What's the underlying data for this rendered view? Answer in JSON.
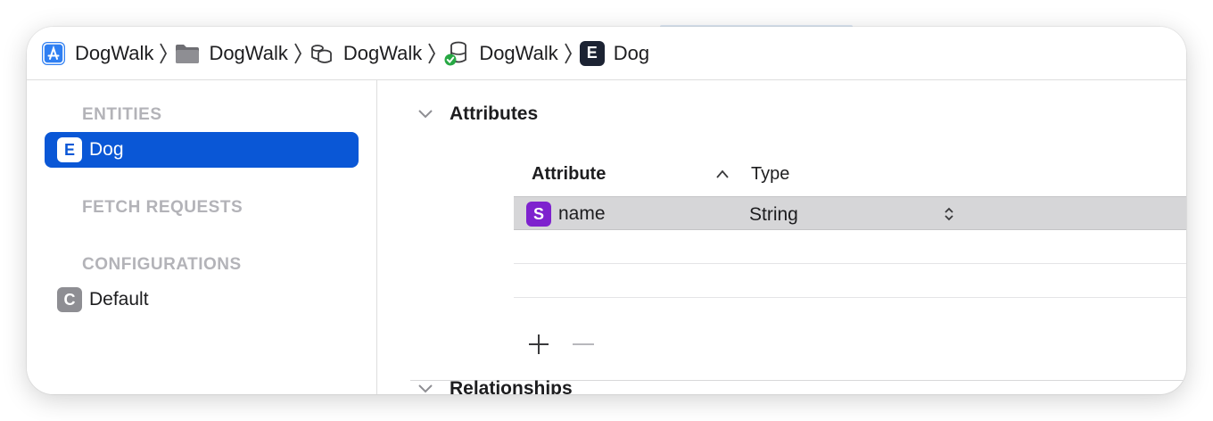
{
  "breadcrumb": [
    {
      "icon": "app-store-icon",
      "label": "DogWalk"
    },
    {
      "icon": "folder-icon",
      "label": "DogWalk"
    },
    {
      "icon": "data-model-group-icon",
      "label": "DogWalk"
    },
    {
      "icon": "data-model-version-icon",
      "label": "DogWalk"
    },
    {
      "icon": "entity-icon",
      "badge": "E",
      "label": "Dog"
    }
  ],
  "sidebar": {
    "entities_heading": "ENTITIES",
    "entities": [
      {
        "badge": "E",
        "label": "Dog",
        "selected": true
      }
    ],
    "fetch_heading": "FETCH REQUESTS",
    "configurations_heading": "CONFIGURATIONS",
    "configurations": [
      {
        "badge": "C",
        "label": "Default"
      }
    ]
  },
  "attributes": {
    "title": "Attributes",
    "col_attribute": "Attribute",
    "col_type": "Type",
    "rows": [
      {
        "badge": "S",
        "name": "name",
        "type": "String"
      }
    ]
  },
  "relationships": {
    "title": "Relationships"
  },
  "colors": {
    "selection": "#0a57d6",
    "string_badge": "#7e22ce",
    "entity_badge": "#1c2333",
    "config_badge": "#8e8e93"
  }
}
